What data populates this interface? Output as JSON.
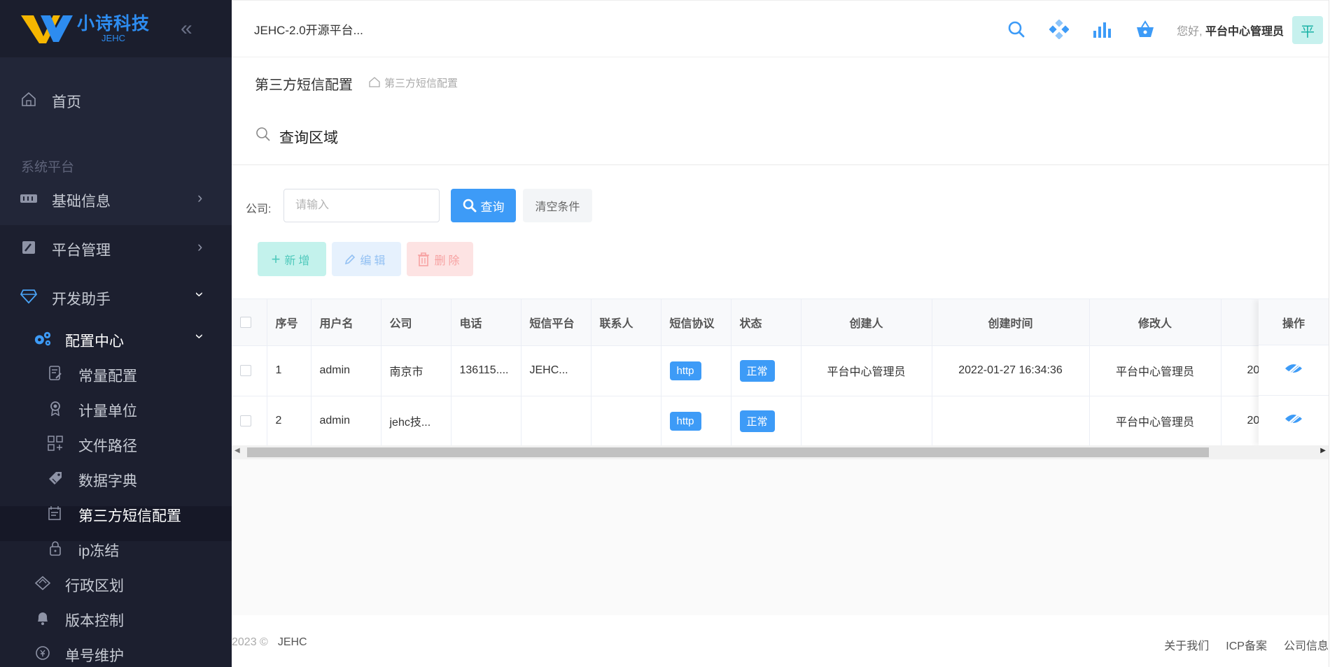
{
  "sidebar": {
    "logo_cn": "小诗科技",
    "logo_en": "JEHC",
    "collapse_glyph": "«",
    "home": "首页",
    "section_title": "系统平台",
    "items": {
      "basic_info": "基础信息",
      "platform_mgmt": "平台管理",
      "dev_helper": "开发助手",
      "config_center": "配置中心",
      "constants": "常量配置",
      "units": "计量单位",
      "file_paths": "文件路径",
      "dictionary": "数据字典",
      "sms_config": "第三方短信配置",
      "ip_freeze": "ip冻结",
      "region": "行政区划",
      "version": "版本控制",
      "serial_no": "单号维护"
    }
  },
  "header": {
    "system_title": "JEHC-2.0开源平台...",
    "greeting_prefix": "您好,",
    "user_name": "平台中心管理员",
    "avatar_char": "平"
  },
  "page": {
    "title": "第三方短信配置",
    "breadcrumb": "第三方短信配置"
  },
  "query": {
    "section_title": "查询区域",
    "company_label": "公司:",
    "company_placeholder": "请输入",
    "search_button": "查询",
    "clear_button": "清空条件"
  },
  "actions": {
    "add": "新增",
    "edit": "编辑",
    "delete": "删除"
  },
  "table": {
    "columns": [
      "序号",
      "用户名",
      "公司",
      "电话",
      "短信平台",
      "联系人",
      "短信协议",
      "状态",
      "创建人",
      "创建时间",
      "修改人",
      ""
    ],
    "operation_header": "操作",
    "rows": [
      {
        "index": "1",
        "username": "admin",
        "company": "南京市",
        "phone": "136115....",
        "platform": "JEHC...",
        "contact": "",
        "protocol": "http",
        "status": "正常",
        "creator": "平台中心管理员",
        "created_at": "2022-01-27 16:34:36",
        "modifier": "平台中心管理员",
        "modified_at": "20"
      },
      {
        "index": "2",
        "username": "admin",
        "company": "jehc技...",
        "phone": "",
        "platform": "",
        "contact": "",
        "protocol": "http",
        "status": "正常",
        "creator": "",
        "created_at": "",
        "modifier": "平台中心管理员",
        "modified_at": "20"
      }
    ]
  },
  "footer": {
    "copyright": "2023 ©",
    "brand": "JEHC",
    "links": [
      "关于我们",
      "ICP备案",
      "公司信息"
    ]
  },
  "colors": {
    "primary": "#3d9bf7",
    "sidebar_bg": "#222638",
    "add_bg": "#c3f2ec",
    "edit_bg": "#e6f1fd",
    "delete_bg": "#fde3e3"
  }
}
